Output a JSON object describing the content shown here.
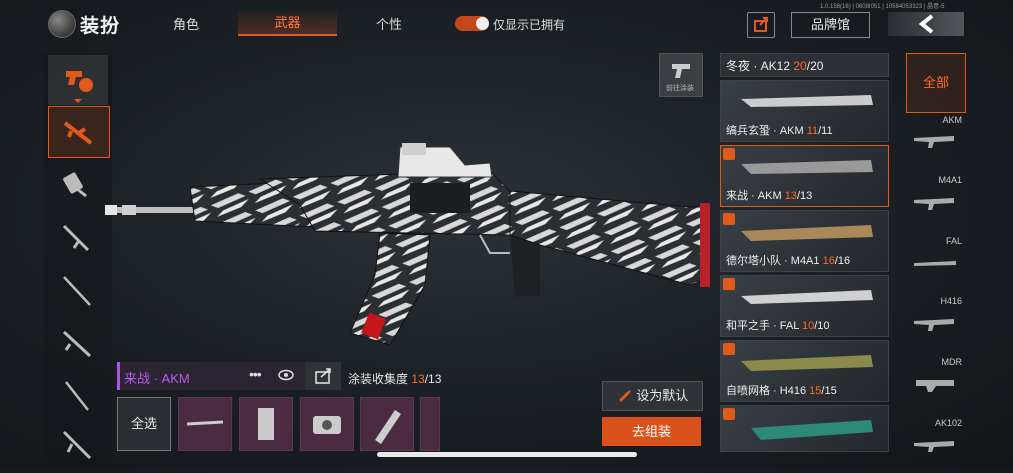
{
  "header": {
    "title": "装扮",
    "tabs": [
      {
        "label": "角色"
      },
      {
        "label": "武器"
      },
      {
        "label": "个性"
      }
    ],
    "toggle_label": "仅显示已拥有",
    "version": "1.0.158(16) | 0608I051 | 10584053323 | 晶意-5",
    "brand_label": "品牌馆"
  },
  "paint_button": {
    "label": "前往涂装"
  },
  "skin": {
    "name": "来战 · AKM",
    "collect_label": "涂装收集度",
    "collect_have": "13",
    "collect_total": "/13"
  },
  "parts": {
    "select_all": "全选"
  },
  "actions": {
    "set_default": "设为默认",
    "assemble": "去组装"
  },
  "skin_list": [
    {
      "name": "冬夜 · AK12",
      "have": "20",
      "total": "/20"
    },
    {
      "name": "缟兵玄蛩 · AKM",
      "have": "11",
      "total": "/11"
    },
    {
      "name": "来战 · AKM",
      "have": "13",
      "total": "/13"
    },
    {
      "name": "德尔塔小队 · M4A1",
      "have": "16",
      "total": "/16"
    },
    {
      "name": "和平之手 · FAL",
      "have": "10",
      "total": "/10"
    },
    {
      "name": "自喷网格 · H416",
      "have": "15",
      "total": "/15"
    }
  ],
  "categories": [
    {
      "label": "全部"
    },
    {
      "label": "AKM"
    },
    {
      "label": "M4A1"
    },
    {
      "label": "FAL"
    },
    {
      "label": "H416"
    },
    {
      "label": "MDR"
    },
    {
      "label": "AK102"
    }
  ],
  "colors": {
    "accent": "#e05a1c",
    "purple": "#b25cf0"
  }
}
